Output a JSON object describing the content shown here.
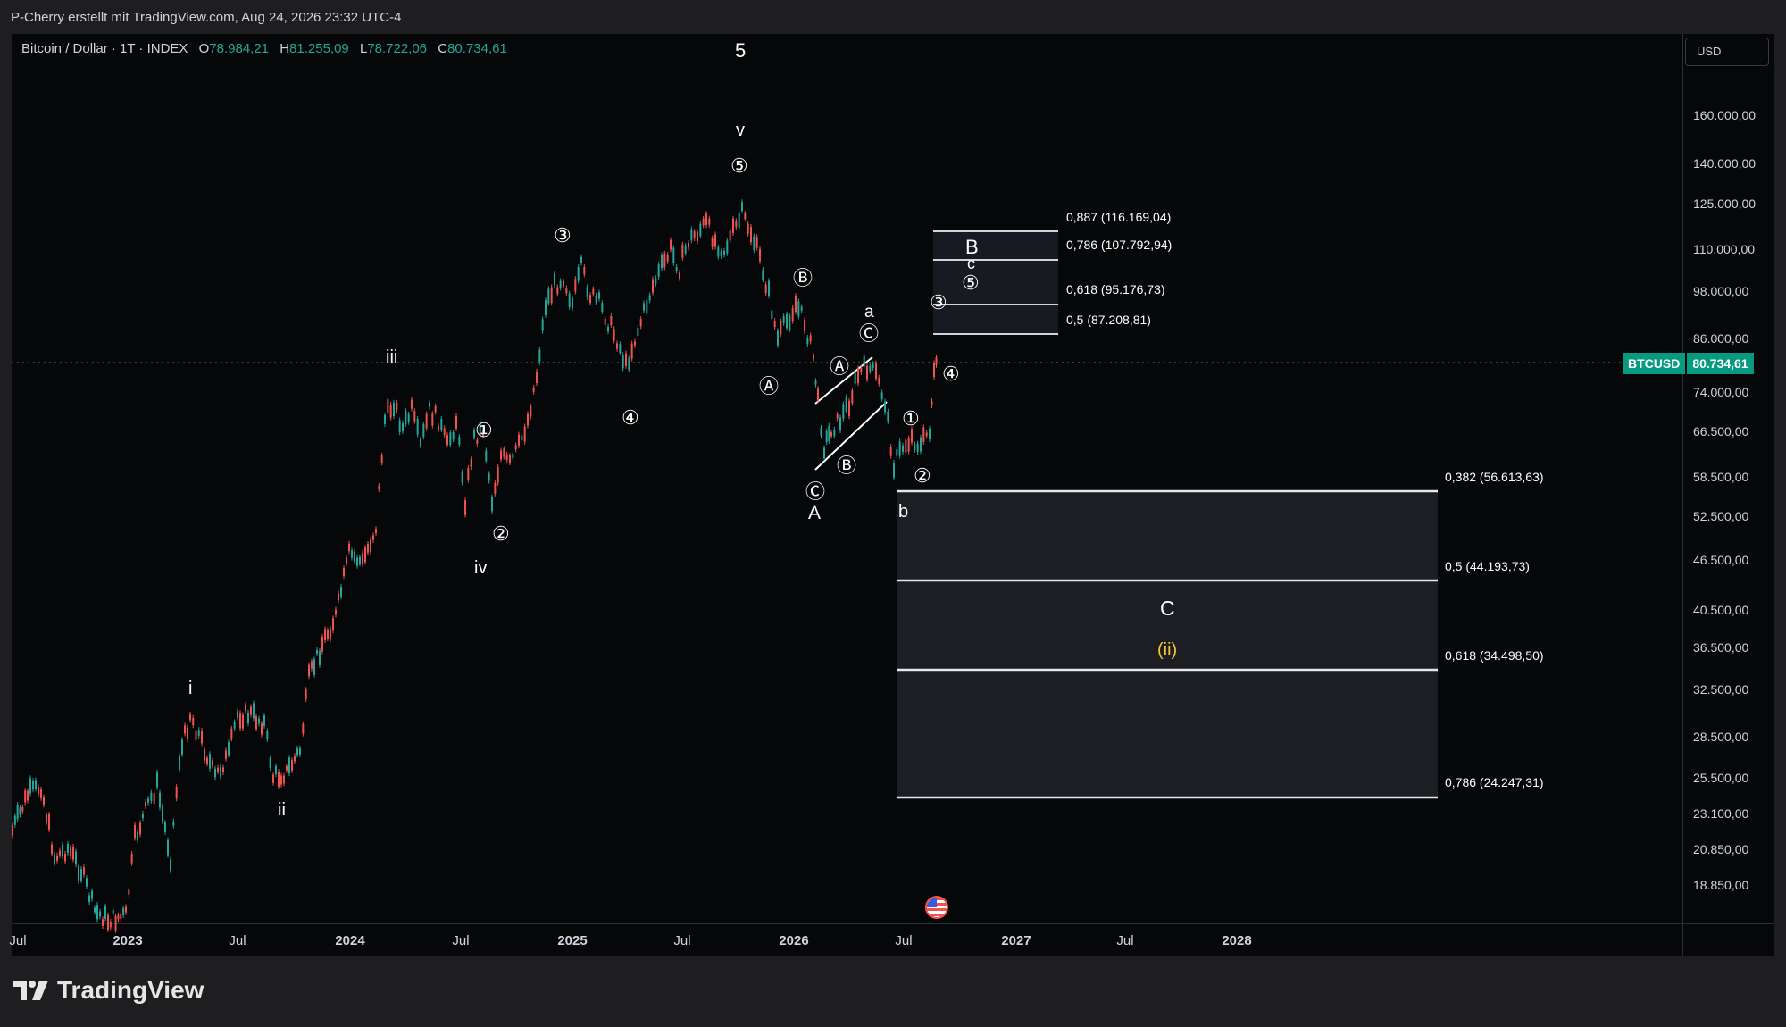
{
  "header": {
    "attribution": "P-Cherry erstellt mit TradingView.com, Aug 24, 2026 23:32 UTC-4"
  },
  "symbol": {
    "name": "Bitcoin / Dollar · 1T · INDEX",
    "o_label": "O",
    "o_value": "78.984,21",
    "h_label": "H",
    "h_value": "81.255,09",
    "l_label": "L",
    "l_value": "78.722,06",
    "c_label": "C",
    "c_value": "80.734,61"
  },
  "currency": "USD",
  "current_price": {
    "symbol": "BTCUSD",
    "value": "80.734,61",
    "color": "#089981"
  },
  "price_axis": [
    "160.000,00",
    "140.000,00",
    "125.000,00",
    "110.000,00",
    "98.000,00",
    "86.000,00",
    "74.000,00",
    "66.500,00",
    "58.500,00",
    "52.500,00",
    "46.500,00",
    "40.500,00",
    "36.500,00",
    "32.500,00",
    "28.500,00",
    "25.500,00",
    "23.100,00",
    "20.850,00",
    "18.850,00"
  ],
  "time_axis": [
    "Jul",
    "2023",
    "Jul",
    "2024",
    "Jul",
    "2025",
    "Jul",
    "2026",
    "Jul",
    "2027",
    "Jul",
    "2028"
  ],
  "fib_upper": [
    {
      "label": "0,887 (116.169,04)"
    },
    {
      "label": "0,786 (107.792,94)"
    },
    {
      "label": "0,618 (95.176,73)"
    },
    {
      "label": "0,5 (87.208,81)"
    }
  ],
  "fib_lower": [
    {
      "label": "0,382 (56.613,63)"
    },
    {
      "label": "0,5 (44.193,73)"
    },
    {
      "label": "0,618 (34.498,50)"
    },
    {
      "label": "0,786 (24.247,31)"
    }
  ],
  "wave_labels": {
    "big_5": "5",
    "v": "v",
    "iii": "iii",
    "iv": "iv",
    "i": "i",
    "ii": "ii",
    "A": "A",
    "a": "a",
    "b": "b",
    "B": "B",
    "c": "c",
    "C": "C",
    "ii_paren": "(ii)"
  },
  "circled": {
    "one": "①",
    "two": "②",
    "three": "③",
    "four": "④",
    "five": "⑤",
    "A": "Ⓐ",
    "B": "Ⓑ",
    "C": "Ⓒ"
  },
  "colors": {
    "up": "#26a69a",
    "down": "#ef5350",
    "accent_yellow": "#f7c531"
  },
  "brand": "TradingView"
}
